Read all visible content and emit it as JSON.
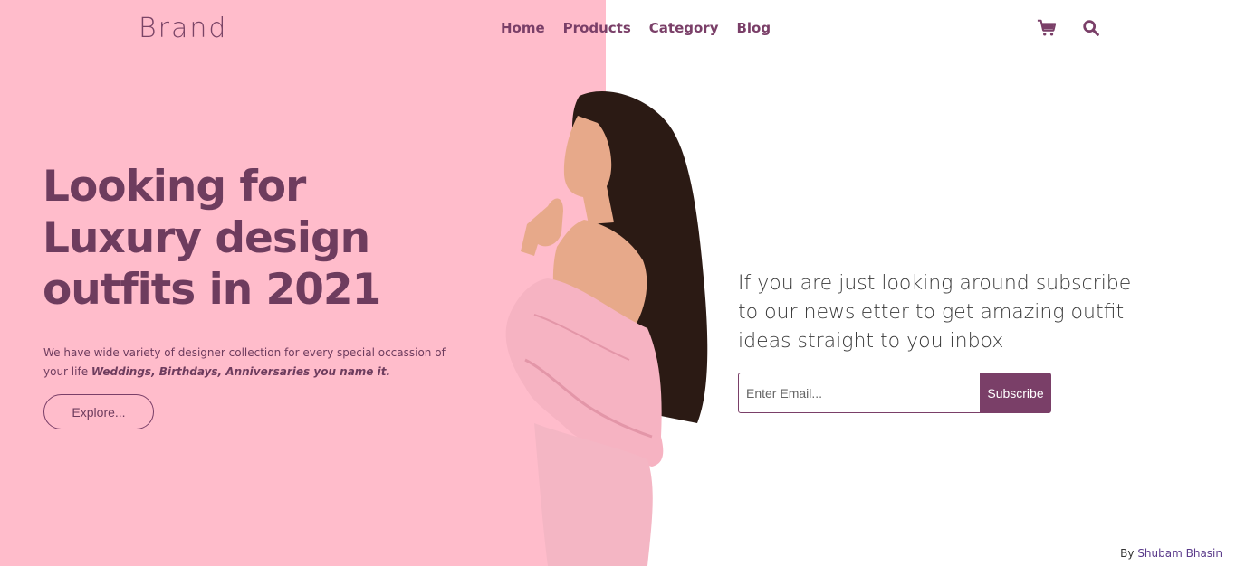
{
  "brand": "Brand",
  "nav": {
    "home": "Home",
    "products": "Products",
    "category": "Category",
    "blog": "Blog"
  },
  "icons": {
    "cart": "cart-icon",
    "search": "search-icon"
  },
  "hero": {
    "title": "Looking for Luxury design outfits in 2021",
    "desc_plain": "We have wide variety of designer collection for every special occassion of your life ",
    "desc_bold": "Weddings, Birthdays, Anniversaries you name it.",
    "cta": "Explore..."
  },
  "newsletter": {
    "text": "If you are just looking around subscribe to our newsletter to get amazing outfit ideas straight to you inbox",
    "placeholder": "Enter Email...",
    "button": "Subscribe"
  },
  "footer": {
    "by": "By ",
    "author": "Shubam Bhasin"
  },
  "colors": {
    "pink_bg": "#ffbccb",
    "accent": "#7a3f68",
    "dress": "#f6b3c2",
    "hair": "#2b1a14",
    "skin": "#e7a98a"
  }
}
